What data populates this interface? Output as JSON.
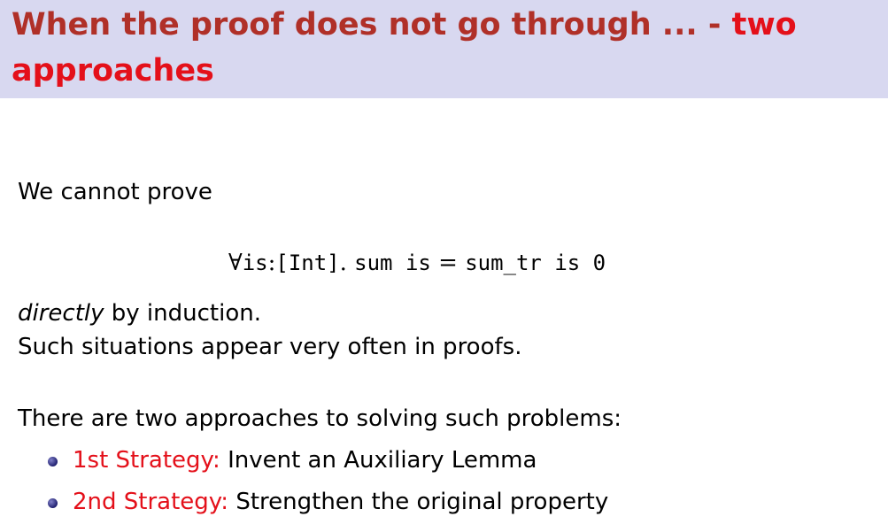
{
  "title": {
    "main": "When the proof does not go through ... - ",
    "accent": "two approaches"
  },
  "body": {
    "intro": "We cannot prove",
    "formula": {
      "forall": "∀",
      "var": "is",
      "colon": ":",
      "type": "[Int]",
      "dot": ".",
      "lhs": "sum is",
      "eq": "=",
      "rhs": "sum_tr is 0"
    },
    "directly_em": "directly",
    "directly_rest": " by induction.",
    "situations": "Such situations appear very often in proofs.",
    "approaches_intro": "There are two approaches to solving such problems:",
    "strategies": [
      {
        "label": "1st Strategy:",
        "text": " Invent an Auxiliary Lemma"
      },
      {
        "label": "2nd Strategy:",
        "text": " Strengthen the original property"
      }
    ]
  },
  "colors": {
    "title_bar": "#d8d8f0",
    "title_text": "#b03028",
    "accent": "#e4101a",
    "bullet": "#202070"
  }
}
